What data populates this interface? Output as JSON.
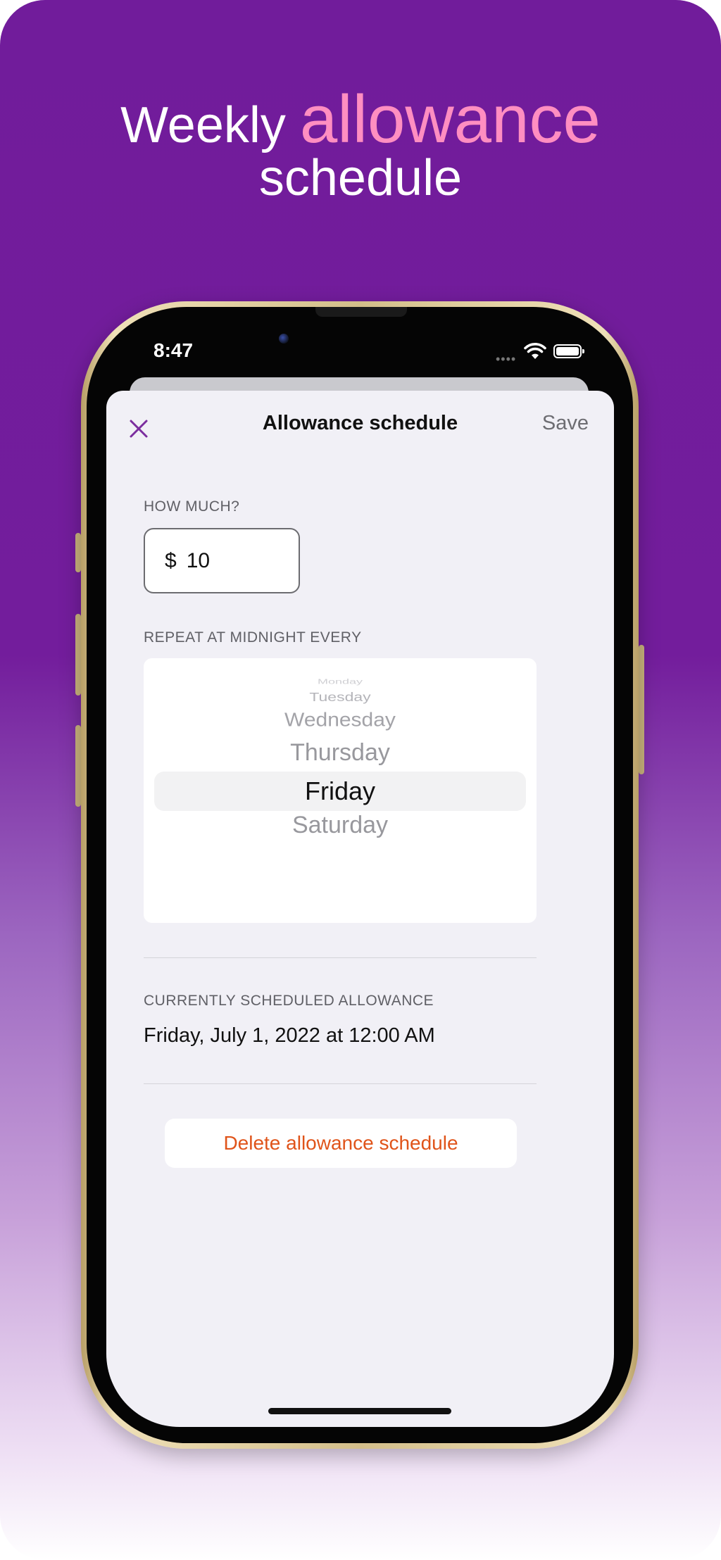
{
  "headline": {
    "line1_prefix": "Weekly",
    "line1_accent": "allowance",
    "line2": "schedule"
  },
  "status_bar": {
    "time": "8:47",
    "signal": "••••"
  },
  "nav": {
    "title": "Allowance schedule",
    "save_label": "Save",
    "close_icon": "close-icon"
  },
  "amount": {
    "label": "HOW MUCH?",
    "currency": "$",
    "value": "10"
  },
  "repeat": {
    "label": "REPEAT AT MIDNIGHT EVERY",
    "options": [
      "Monday",
      "Tuesday",
      "Wednesday",
      "Thursday",
      "Friday",
      "Saturday"
    ],
    "selected": "Friday"
  },
  "scheduled": {
    "label": "CURRENTLY SCHEDULED ALLOWANCE",
    "value": "Friday, July 1, 2022 at 12:00 AM"
  },
  "delete_label": "Delete allowance schedule",
  "colors": {
    "background": "#711c9b",
    "accent_text": "#ff8ec1",
    "close_icon": "#7b2d9e",
    "delete_text": "#e0541a"
  }
}
